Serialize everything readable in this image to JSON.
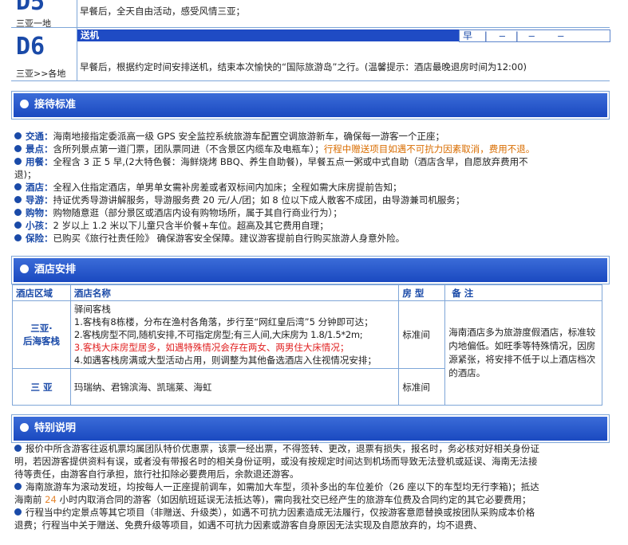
{
  "days": [
    {
      "code": "D5",
      "route": "三亚一地",
      "desc": "早餐后，全天自由活动，感受风情三亚；"
    },
    {
      "code": "D6",
      "route": "三亚>>各地",
      "title": "送机",
      "meals": [
        "早",
        "|",
        "—",
        "|",
        "—",
        "—"
      ],
      "desc": "早餐后，根据约定时间安排送机，结束本次愉快的“国际旅游岛”之行。(温馨提示：酒店最晚退房时间为12:00)"
    }
  ],
  "sections": {
    "reception": "接待标准",
    "hotel": "酒店安排",
    "special": "特别说明"
  },
  "reception": [
    {
      "label": "交通：",
      "text": "海南地接指定委派高一级 GPS 安全监控系统旅游车配置空调旅游新车，确保每一游客一个正座；"
    },
    {
      "label": "景点：",
      "text": "含所列景点第一道门票，团队票同进（不含景区内缆车及电瓶车）；",
      "warn": "行程中赠送项目如遇不可抗力因素取消，费用不退。"
    },
    {
      "label": "用餐：",
      "text": "全程含 3 正 5 早,(2大特色餐：海鲜烧烤 BBQ、养生自助餐)，早餐五点一粥或中式自助（酒店含早，自愿放弃费用不退)；"
    },
    {
      "label": "酒店：",
      "text": "全程入住指定酒店，单男单女需补房差或者双标间内加床；全程如需大床房提前告知；"
    },
    {
      "label": "导游：",
      "text": "持证优秀导游讲解服务，导游服务费 20 元/人/团；如 8 位以下成人散客不成团，由导游兼司机服务；"
    },
    {
      "label": "购物：",
      "text": "购物随意逛（部分景区或酒店内设有购物场所，属于其自行商业行为）；"
    },
    {
      "label": "小孩：",
      "text": "2 岁以上 1.2 米以下儿童只含半价餐+车位。超高及其它费用自理；"
    },
    {
      "label": "保险：",
      "text": "已购买《旅行社责任险》 确保游客安全保障。建议游客提前自行购买旅游人身意外险。"
    }
  ],
  "hotel_table": {
    "headers": [
      "酒店区域",
      "酒店名称",
      "房 型",
      "备  注"
    ],
    "rows": [
      {
        "region": "三亚·\n后海客栈",
        "hotel_lines": [
          "驿间客栈",
          "1.客栈有8栋楼，分布在渔村各角落，步行至“网红皇后湾”5 分钟即可达；",
          "2.客栈房型不同,随机安排,不可指定房型;有三人间,大床房为 1.8/1.5*2m;",
          "3.客栈大床房型居多，如遇特殊情况会存在两女、两男住大床情况；",
          "4.如遇客栈房满或大型活动占用，则调整为其他备选酒店入住视情况安排；"
        ],
        "room": "标准间"
      },
      {
        "region": "三 亚",
        "hotel_lines": [
          "玛瑞纳、君锦滨海、凯瑞莱、海虹"
        ],
        "room": "标准间"
      }
    ],
    "note": "海南酒店多为旅游度假酒店，标准较内地偏低。如旺季等特殊情况，因房源紧张，将安排不低于以上酒店档次的酒店。"
  },
  "special": [
    {
      "text": "报价中所含游客往返机票均属团队特价优惠票，该票一经出票，不得签转、更改，退票有损失，报名时，务必核对好相关身份证明，若因游客提供资料有误，或者没有带报名时的相关身份证明，或没有按规定时间达到机场而导致无法登机或延误、海南无法接待等责任，由游客自行承担，旅行社扣除必要费用后，余款退还游客。"
    },
    {
      "text_a": "海南旅游车为滚动发班，均按每人一正座提前调车，如需加大车型，须补多出的车位差价（26 座以下的车型均无行李箱)；抵达海南前 ",
      "num": "24",
      "text_b": " 小时内取消合同的游客（如因航班延误无法抵达等)，需向我社交已经产生的旅游车位费及合同约定的其它必要费用；"
    },
    {
      "text": "行程当中约定景点等其它项目（非赠送、升级类），如遇不可抗力因素造成无法履行，仅按游客意愿替换或按团队采购成本价格退费；行程当中关于赠送、免费升级等项目，如遇不可抗力因素或游客自身原因无法实现及自愿放弃的，均不退费、"
    }
  ]
}
